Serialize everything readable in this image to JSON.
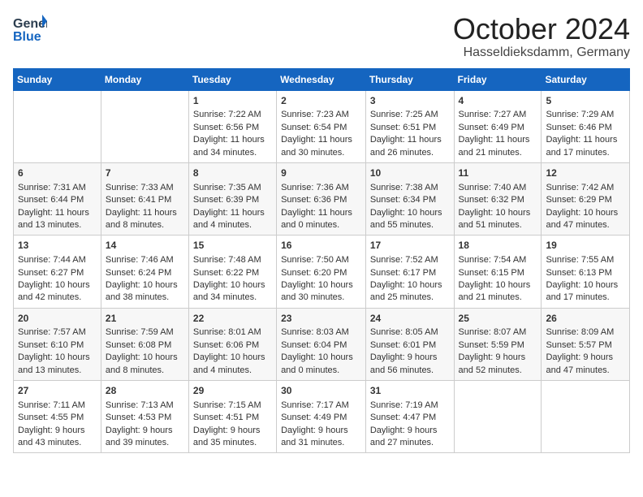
{
  "header": {
    "logo_line1": "General",
    "logo_line2": "Blue",
    "title": "October 2024",
    "subtitle": "Hasseldieksdamm, Germany"
  },
  "calendar": {
    "days_of_week": [
      "Sunday",
      "Monday",
      "Tuesday",
      "Wednesday",
      "Thursday",
      "Friday",
      "Saturday"
    ],
    "weeks": [
      [
        {
          "day": "",
          "content": ""
        },
        {
          "day": "",
          "content": ""
        },
        {
          "day": "1",
          "content": "Sunrise: 7:22 AM\nSunset: 6:56 PM\nDaylight: 11 hours\nand 34 minutes."
        },
        {
          "day": "2",
          "content": "Sunrise: 7:23 AM\nSunset: 6:54 PM\nDaylight: 11 hours\nand 30 minutes."
        },
        {
          "day": "3",
          "content": "Sunrise: 7:25 AM\nSunset: 6:51 PM\nDaylight: 11 hours\nand 26 minutes."
        },
        {
          "day": "4",
          "content": "Sunrise: 7:27 AM\nSunset: 6:49 PM\nDaylight: 11 hours\nand 21 minutes."
        },
        {
          "day": "5",
          "content": "Sunrise: 7:29 AM\nSunset: 6:46 PM\nDaylight: 11 hours\nand 17 minutes."
        }
      ],
      [
        {
          "day": "6",
          "content": "Sunrise: 7:31 AM\nSunset: 6:44 PM\nDaylight: 11 hours\nand 13 minutes."
        },
        {
          "day": "7",
          "content": "Sunrise: 7:33 AM\nSunset: 6:41 PM\nDaylight: 11 hours\nand 8 minutes."
        },
        {
          "day": "8",
          "content": "Sunrise: 7:35 AM\nSunset: 6:39 PM\nDaylight: 11 hours\nand 4 minutes."
        },
        {
          "day": "9",
          "content": "Sunrise: 7:36 AM\nSunset: 6:36 PM\nDaylight: 11 hours\nand 0 minutes."
        },
        {
          "day": "10",
          "content": "Sunrise: 7:38 AM\nSunset: 6:34 PM\nDaylight: 10 hours\nand 55 minutes."
        },
        {
          "day": "11",
          "content": "Sunrise: 7:40 AM\nSunset: 6:32 PM\nDaylight: 10 hours\nand 51 minutes."
        },
        {
          "day": "12",
          "content": "Sunrise: 7:42 AM\nSunset: 6:29 PM\nDaylight: 10 hours\nand 47 minutes."
        }
      ],
      [
        {
          "day": "13",
          "content": "Sunrise: 7:44 AM\nSunset: 6:27 PM\nDaylight: 10 hours\nand 42 minutes."
        },
        {
          "day": "14",
          "content": "Sunrise: 7:46 AM\nSunset: 6:24 PM\nDaylight: 10 hours\nand 38 minutes."
        },
        {
          "day": "15",
          "content": "Sunrise: 7:48 AM\nSunset: 6:22 PM\nDaylight: 10 hours\nand 34 minutes."
        },
        {
          "day": "16",
          "content": "Sunrise: 7:50 AM\nSunset: 6:20 PM\nDaylight: 10 hours\nand 30 minutes."
        },
        {
          "day": "17",
          "content": "Sunrise: 7:52 AM\nSunset: 6:17 PM\nDaylight: 10 hours\nand 25 minutes."
        },
        {
          "day": "18",
          "content": "Sunrise: 7:54 AM\nSunset: 6:15 PM\nDaylight: 10 hours\nand 21 minutes."
        },
        {
          "day": "19",
          "content": "Sunrise: 7:55 AM\nSunset: 6:13 PM\nDaylight: 10 hours\nand 17 minutes."
        }
      ],
      [
        {
          "day": "20",
          "content": "Sunrise: 7:57 AM\nSunset: 6:10 PM\nDaylight: 10 hours\nand 13 minutes."
        },
        {
          "day": "21",
          "content": "Sunrise: 7:59 AM\nSunset: 6:08 PM\nDaylight: 10 hours\nand 8 minutes."
        },
        {
          "day": "22",
          "content": "Sunrise: 8:01 AM\nSunset: 6:06 PM\nDaylight: 10 hours\nand 4 minutes."
        },
        {
          "day": "23",
          "content": "Sunrise: 8:03 AM\nSunset: 6:04 PM\nDaylight: 10 hours\nand 0 minutes."
        },
        {
          "day": "24",
          "content": "Sunrise: 8:05 AM\nSunset: 6:01 PM\nDaylight: 9 hours\nand 56 minutes."
        },
        {
          "day": "25",
          "content": "Sunrise: 8:07 AM\nSunset: 5:59 PM\nDaylight: 9 hours\nand 52 minutes."
        },
        {
          "day": "26",
          "content": "Sunrise: 8:09 AM\nSunset: 5:57 PM\nDaylight: 9 hours\nand 47 minutes."
        }
      ],
      [
        {
          "day": "27",
          "content": "Sunrise: 7:11 AM\nSunset: 4:55 PM\nDaylight: 9 hours\nand 43 minutes."
        },
        {
          "day": "28",
          "content": "Sunrise: 7:13 AM\nSunset: 4:53 PM\nDaylight: 9 hours\nand 39 minutes."
        },
        {
          "day": "29",
          "content": "Sunrise: 7:15 AM\nSunset: 4:51 PM\nDaylight: 9 hours\nand 35 minutes."
        },
        {
          "day": "30",
          "content": "Sunrise: 7:17 AM\nSunset: 4:49 PM\nDaylight: 9 hours\nand 31 minutes."
        },
        {
          "day": "31",
          "content": "Sunrise: 7:19 AM\nSunset: 4:47 PM\nDaylight: 9 hours\nand 27 minutes."
        },
        {
          "day": "",
          "content": ""
        },
        {
          "day": "",
          "content": ""
        }
      ]
    ]
  }
}
